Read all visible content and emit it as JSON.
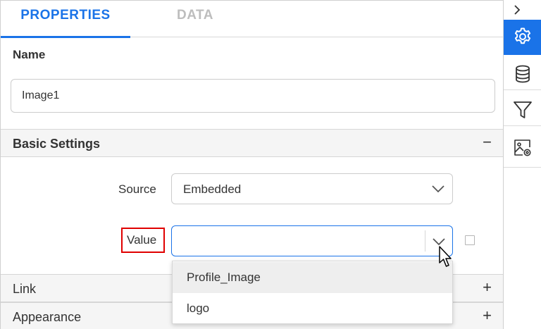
{
  "tabs": [
    {
      "label": "PROPERTIES",
      "active": true
    },
    {
      "label": "DATA",
      "active": false
    }
  ],
  "name_section": {
    "label": "Name",
    "value": "Image1"
  },
  "basic_settings": {
    "title": "Basic Settings",
    "toggle": "−",
    "source": {
      "label": "Source",
      "selected": "Embedded"
    },
    "value": {
      "label": "Value",
      "selected": "",
      "options": [
        "Profile_Image",
        "logo"
      ]
    }
  },
  "sections": {
    "link": {
      "title": "Link",
      "toggle": "+"
    },
    "appearance": {
      "title": "Appearance",
      "toggle": "+"
    }
  },
  "rail": {
    "collapse_icon": "chevron-right-icon",
    "items": [
      "gear-icon",
      "database-icon",
      "filter-icon",
      "image-settings-icon"
    ]
  },
  "colors": {
    "accent": "#1a73e8",
    "highlight_border": "#e00000"
  }
}
